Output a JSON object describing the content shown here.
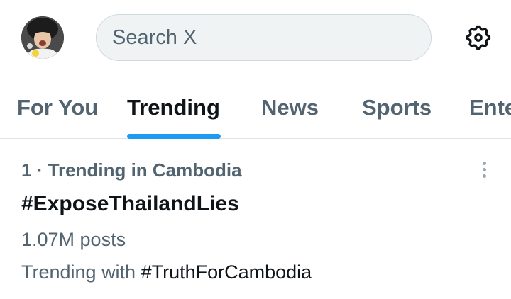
{
  "header": {
    "avatar_icon": "user-avatar",
    "search_placeholder": "Search X",
    "settings_icon": "gear-icon"
  },
  "tabs": [
    {
      "label": "For You",
      "active": false
    },
    {
      "label": "Trending",
      "active": true
    },
    {
      "label": "News",
      "active": false
    },
    {
      "label": "Sports",
      "active": false
    },
    {
      "label": "Entertainment",
      "active": false
    }
  ],
  "trend": {
    "rank": "1",
    "separator": " · ",
    "context": "Trending in Cambodia",
    "name": "#ExposeThailandLies",
    "posts": "1.07M posts",
    "with_label": "Trending with",
    "with_tag": "#TruthForCambodia",
    "more_icon": "more-vertical-icon"
  },
  "colors": {
    "accent": "#1d9bf0",
    "text_primary": "#0f1419",
    "text_secondary": "#536471",
    "search_bg": "#eff3f4"
  }
}
